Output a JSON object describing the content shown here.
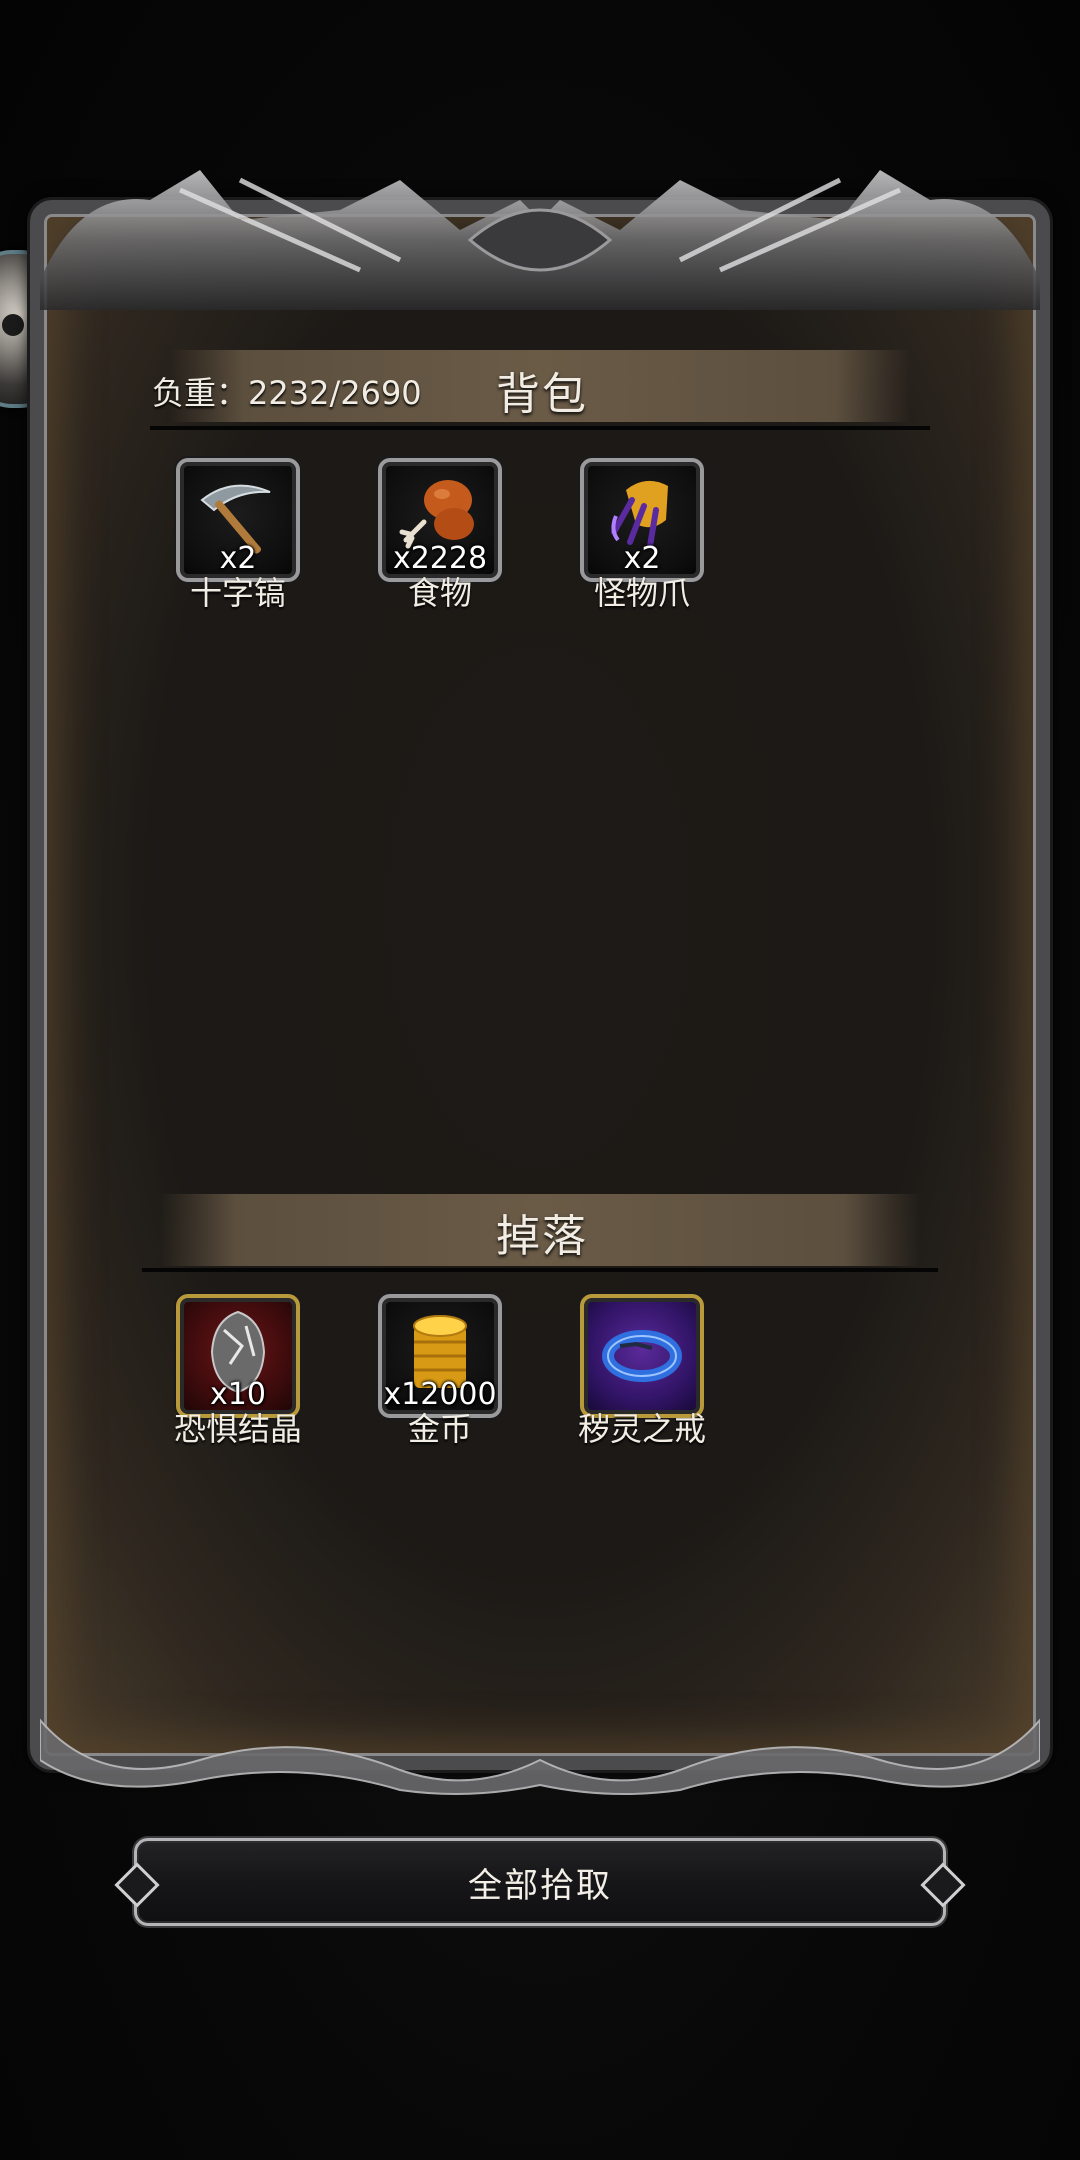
{
  "inventory": {
    "weight_label": "负重：2232/2690",
    "title": "背包",
    "items": [
      {
        "name": "十字镐",
        "qty": "x2",
        "icon": "pickaxe-icon"
      },
      {
        "name": "食物",
        "qty": "x2228",
        "icon": "drumstick-icon"
      },
      {
        "name": "怪物爪",
        "qty": "x2",
        "icon": "monster-claw-icon"
      }
    ]
  },
  "drops": {
    "title": "掉落",
    "items": [
      {
        "name": "恐惧结晶",
        "qty": "x10",
        "icon": "fear-crystal-icon"
      },
      {
        "name": "金币",
        "qty": "x12000",
        "icon": "gold-coins-icon"
      },
      {
        "name": "秽灵之戒",
        "qty": "",
        "icon": "ring-icon"
      }
    ]
  },
  "actions": {
    "pickup_all_label": "全部拾取"
  },
  "colors": {
    "panel_border": "#4b4b4d",
    "banner": "#6a5b47",
    "text": "#f2ede4",
    "rare_slot_border": "#b89a3a"
  }
}
